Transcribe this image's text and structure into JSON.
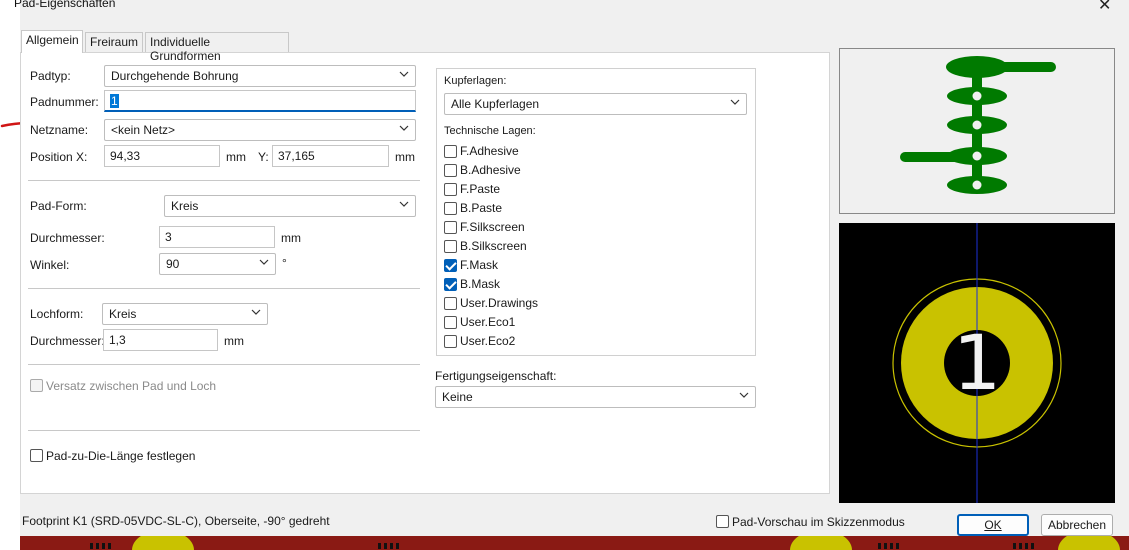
{
  "window": {
    "title": "Pad-Eigenschaften",
    "close_glyph": "✕"
  },
  "tabs": [
    {
      "label": "Allgemein",
      "active": true
    },
    {
      "label": "Freiraum",
      "active": false
    },
    {
      "label": "Individuelle Grundformen",
      "active": false
    }
  ],
  "general": {
    "padtype_label": "Padtyp:",
    "padtype_value": "Durchgehende Bohrung",
    "padnumber_label": "Padnummer:",
    "padnumber_value": "1",
    "netname_label": "Netzname:",
    "netname_value": "<kein Netz>",
    "posx_label": "Position X:",
    "posx_value": "94,33",
    "posx_unit": "mm",
    "posy_label": "Y:",
    "posy_value": "37,165",
    "posy_unit": "mm",
    "padshape_label": "Pad-Form:",
    "padshape_value": "Kreis",
    "diameter_label": "Durchmesser:",
    "diameter_value": "3",
    "diameter_unit": "mm",
    "angle_label": "Winkel:",
    "angle_value": "90",
    "angle_unit": "°",
    "holeshape_label": "Lochform:",
    "holeshape_value": "Kreis",
    "hole_diameter_label": "Durchmesser:",
    "hole_diameter_value": "1,3",
    "hole_diameter_unit": "mm",
    "offset_label": "Versatz zwischen Pad und Loch",
    "pad_die_label": "Pad-zu-Die-Länge festlegen"
  },
  "layers": {
    "copper_label": "Kupferlagen:",
    "copper_value": "Alle Kupferlagen",
    "tech_label": "Technische Lagen:",
    "items": [
      {
        "label": "F.Adhesive",
        "checked": false
      },
      {
        "label": "B.Adhesive",
        "checked": false
      },
      {
        "label": "F.Paste",
        "checked": false
      },
      {
        "label": "B.Paste",
        "checked": false
      },
      {
        "label": "F.Silkscreen",
        "checked": false
      },
      {
        "label": "B.Silkscreen",
        "checked": false
      },
      {
        "label": "F.Mask",
        "checked": true
      },
      {
        "label": "B.Mask",
        "checked": true
      },
      {
        "label": "User.Drawings",
        "checked": false
      },
      {
        "label": "User.Eco1",
        "checked": false
      },
      {
        "label": "User.Eco2",
        "checked": false
      }
    ],
    "fab_label": "Fertigungseigenschaft:",
    "fab_value": "Keine"
  },
  "preview": {
    "pad_number": "1",
    "pad_color": "#c9c200",
    "shape_color": "#007a00"
  },
  "footer": {
    "status": "Footprint K1 (SRD-05VDC-SL-C), Oberseite, -90° gedreht",
    "sketch_label": "Pad-Vorschau im Skizzenmodus",
    "ok_label": "OK",
    "cancel_label": "Abbrechen"
  }
}
